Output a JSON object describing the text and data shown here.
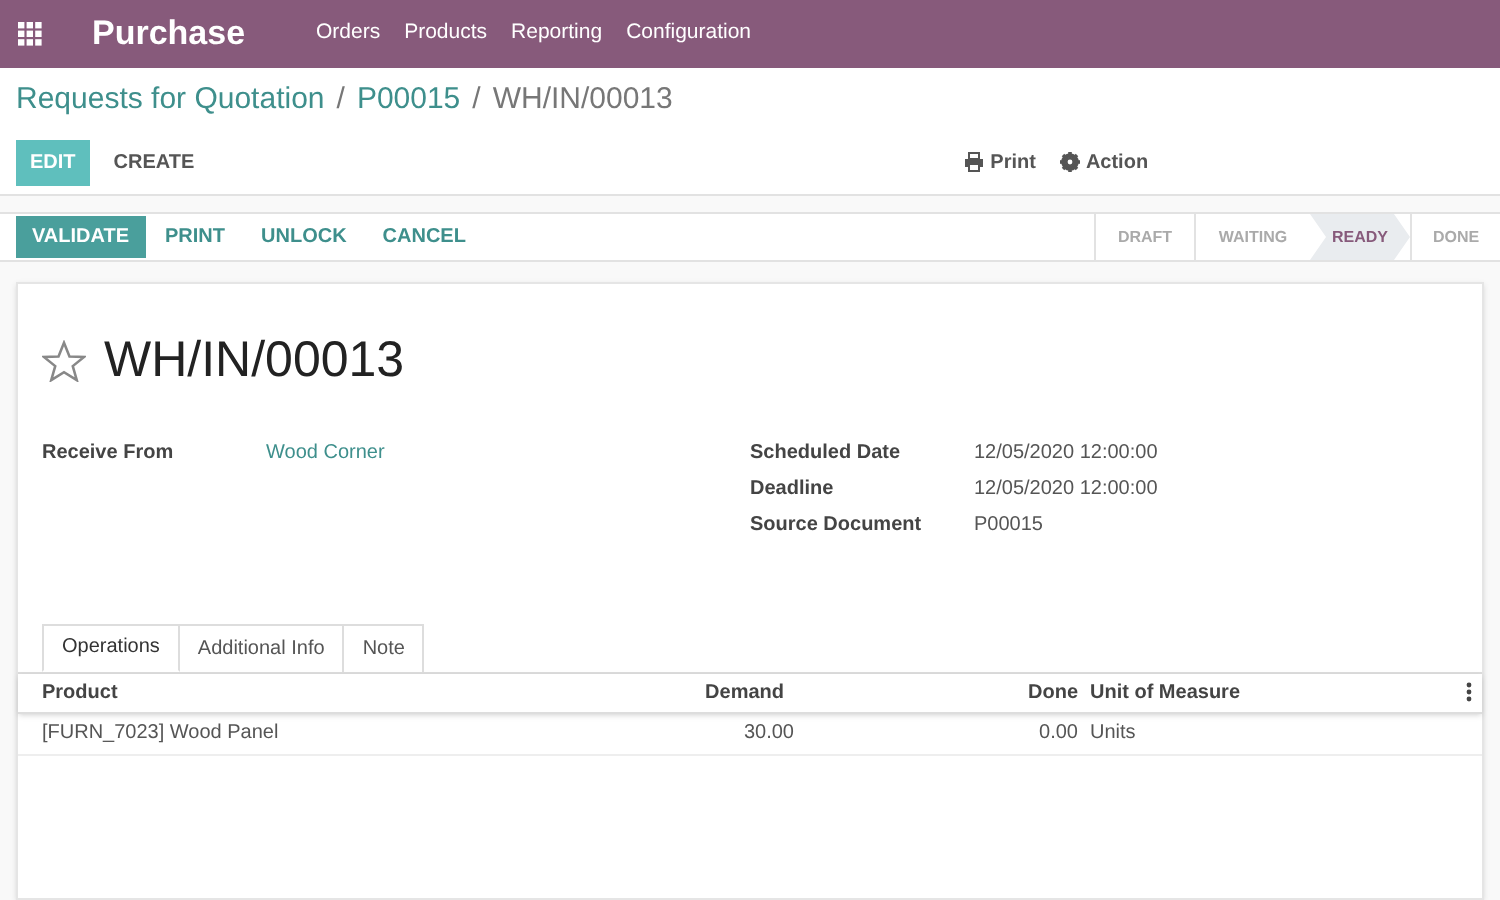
{
  "navbar": {
    "app": "Purchase",
    "menu": [
      "Orders",
      "Products",
      "Reporting",
      "Configuration"
    ]
  },
  "breadcrumb": [
    {
      "text": "Requests for Quotation",
      "kind": "link"
    },
    {
      "text": "/",
      "kind": "separator"
    },
    {
      "text": "P00015",
      "kind": "link"
    },
    {
      "text": "/",
      "kind": "separator"
    },
    {
      "text": "WH/IN/00013",
      "kind": "current"
    }
  ],
  "control_buttons": [
    {
      "label": "EDIT",
      "kind": "primary"
    },
    {
      "label": "CREATE",
      "kind": "plain"
    }
  ],
  "sidebar_actions": [
    {
      "label": "Print",
      "kind": "print"
    },
    {
      "label": "Action",
      "kind": "gear"
    }
  ],
  "header_buttons": [
    {
      "label": "VALIDATE",
      "kind": "primary"
    },
    {
      "label": "PRINT",
      "kind": "plain"
    },
    {
      "label": "UNLOCK",
      "kind": "plain"
    },
    {
      "label": "CANCEL",
      "kind": "plain"
    }
  ],
  "status_steps": [
    {
      "label": "DRAFT",
      "selected": false
    },
    {
      "label": "WAITING",
      "selected": false
    },
    {
      "label": "READY",
      "selected": true
    },
    {
      "label": "DONE",
      "selected": false
    }
  ],
  "record": {
    "title": "WH/IN/00013",
    "starred": false
  },
  "left_fields": [
    {
      "label": "Receive From",
      "value": "Wood Corner",
      "kind": "link"
    }
  ],
  "right_fields": [
    {
      "label": "Scheduled Date",
      "value": "12/05/2020 12:00:00",
      "kind": "text"
    },
    {
      "label": "Deadline",
      "value": "12/05/2020 12:00:00",
      "kind": "text"
    },
    {
      "label": "Source Document",
      "value": "P00015",
      "kind": "text"
    }
  ],
  "notebook_tabs": [
    {
      "label": "Operations",
      "selected": true
    },
    {
      "label": "Additional Info",
      "selected": false
    },
    {
      "label": "Note",
      "selected": false
    }
  ],
  "table": {
    "columns": [
      "Product",
      "Demand",
      "Done",
      "Unit of Measure"
    ],
    "rows": [
      [
        "[FURN_7023] Wood Panel",
        "30.00",
        "0.00",
        "Units"
      ]
    ]
  }
}
